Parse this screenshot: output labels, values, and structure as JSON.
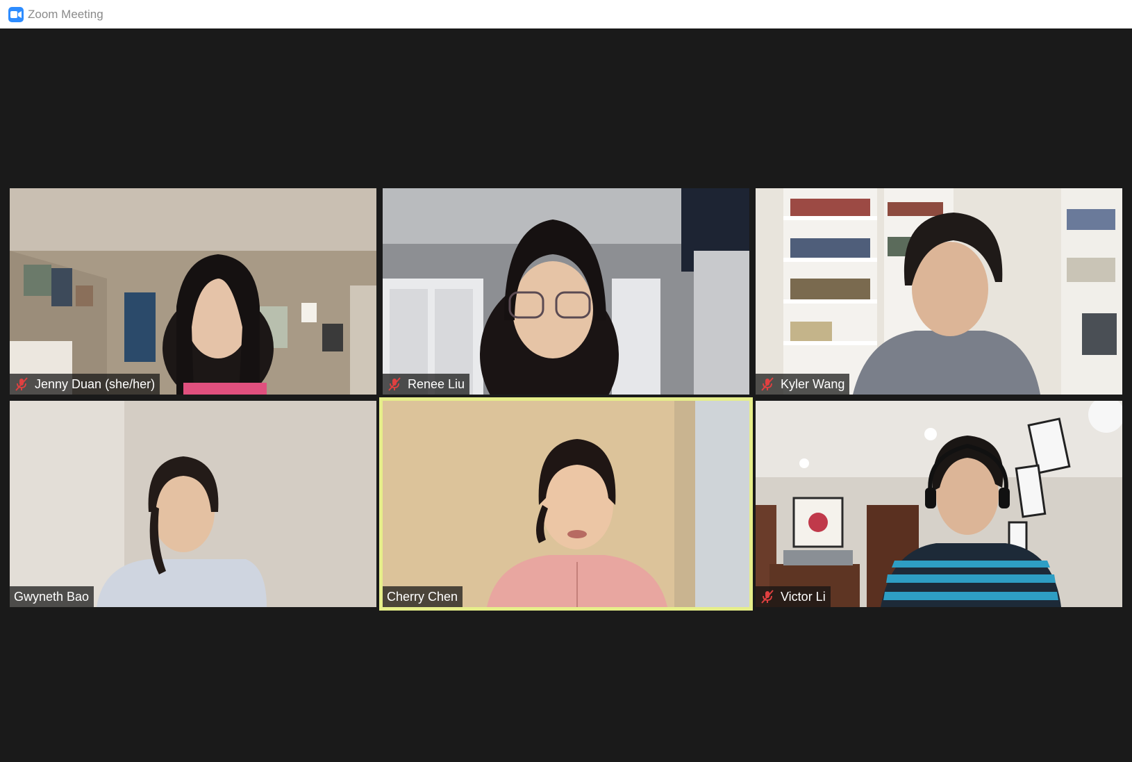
{
  "window": {
    "title": "Zoom Meeting",
    "icon": "zoom-camera-icon",
    "accent": "#2d8cff"
  },
  "gallery": {
    "active_speaker_color": "#e6ee8a",
    "participants": [
      {
        "name": "Jenny Duan (she/her)",
        "muted": true
      },
      {
        "name": "Renee Liu",
        "muted": true
      },
      {
        "name": "Kyler Wang",
        "muted": true
      },
      {
        "name": "Gwyneth Bao",
        "muted": false
      },
      {
        "name": "Cherry Chen",
        "muted": false,
        "active_speaker": true
      },
      {
        "name": "Victor Li",
        "muted": true
      }
    ]
  }
}
